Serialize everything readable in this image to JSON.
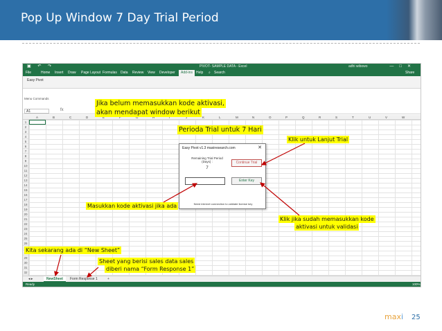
{
  "slide": {
    "title": "Pop Up Window 7 Day Trial Period",
    "page_number": "25",
    "logo_text_a": "max",
    "logo_text_b": "i"
  },
  "excel": {
    "window_title": "PIVOT- SAMPLE DATA  -  Excel",
    "user": "adhi wibowo",
    "qat_icons": [
      "save-icon",
      "undo-icon",
      "redo-icon"
    ],
    "window_controls": [
      "—",
      "□",
      "✕"
    ],
    "ribbon_tabs": [
      "File",
      "Home",
      "Insert",
      "Draw",
      "Page Layout",
      "Formulas",
      "Data",
      "Review",
      "View",
      "Developer",
      "Add-ins",
      "Help"
    ],
    "active_tab": "Add-ins",
    "search_placeholder": "Search",
    "share_label": "Share",
    "ribbon_button": "Easy Pivot",
    "ribbon_group": "Menu Commands",
    "name_box": "A1",
    "fx_label": "fx",
    "columns": [
      "A",
      "B",
      "C",
      "D",
      "E",
      "F",
      "G",
      "H",
      "I",
      "J",
      "K",
      "L",
      "M",
      "N",
      "O",
      "P",
      "Q",
      "R",
      "S",
      "T",
      "U",
      "V",
      "W"
    ],
    "rows": [
      "1",
      "2",
      "3",
      "4",
      "5",
      "6",
      "7",
      "8",
      "9",
      "10",
      "11",
      "12",
      "13",
      "14",
      "15",
      "16",
      "17",
      "18",
      "19",
      "20",
      "21",
      "22",
      "23",
      "24",
      "25",
      "26",
      "27",
      "28",
      "29",
      "30",
      "31",
      "32"
    ],
    "sheet_tabs": [
      "NewSheet",
      "Form Response 1"
    ],
    "add_sheet": "+",
    "status_left": "Ready",
    "status_right": "100%"
  },
  "dialog": {
    "title": "Easy Pivot v1.3    maxiresearch.com",
    "close": "✕",
    "remaining_label": "Remaining Trial Period (Days) :",
    "days_value": "7",
    "continue_label": "Continue Trial",
    "enter_label": "Enter Key",
    "note": "Need internet connection to validate license key"
  },
  "callouts": {
    "top": "Jika belum memasukkan kode aktivasi,\nakan mendapat window berikut",
    "top_line1": "Jika belum memasukkan kode aktivasi,",
    "top_line2": "akan mendapat window berikut",
    "period": "Perioda Trial untuk 7 Hari",
    "continue": "Klik untuk Lanjut Trial",
    "enter_code": "Masukkan kode aktivasi jika ada",
    "after_code_line1": "Klik jika sudah memasukkan kode",
    "after_code_line2": "aktivasi untuk validasi",
    "new_sheet": "Kita sekarang ada di “New Sheet”",
    "sheet_line1": "Sheet yang berisi sales data sales",
    "sheet_line2": "diberi nama “Form Response 1”"
  },
  "colors": {
    "header_blue": "#2d6fa8",
    "excel_green": "#217346",
    "callout_yellow": "#ffff00",
    "arrow_red": "#c00000"
  }
}
